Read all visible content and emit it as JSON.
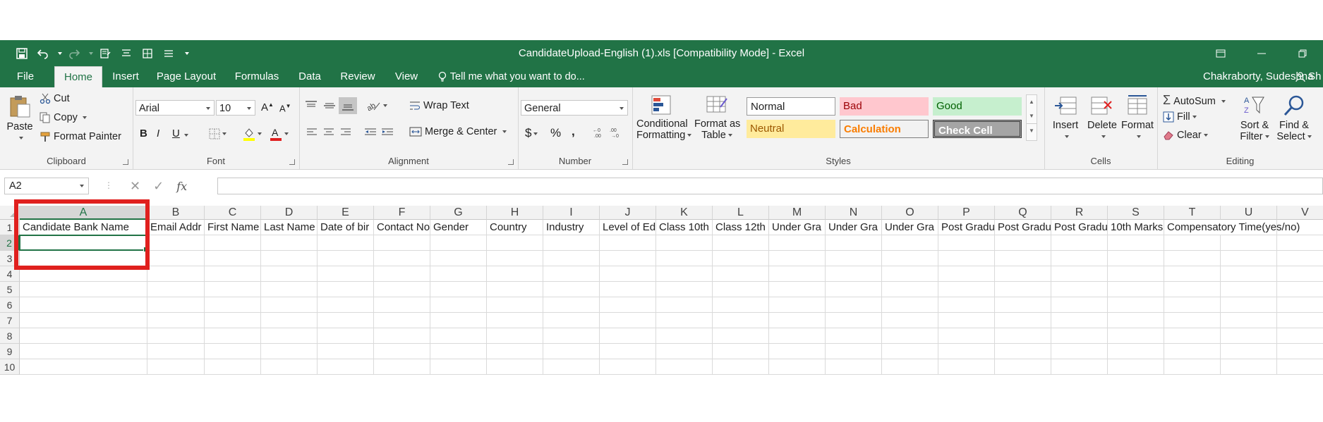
{
  "window": {
    "title": "CandidateUpload-English (1).xls  [Compatibility Mode] - Excel"
  },
  "tabs": [
    {
      "label": "File",
      "active": false
    },
    {
      "label": "Home",
      "active": true
    },
    {
      "label": "Insert",
      "active": false
    },
    {
      "label": "Page Layout",
      "active": false
    },
    {
      "label": "Formulas",
      "active": false
    },
    {
      "label": "Data",
      "active": false
    },
    {
      "label": "Review",
      "active": false
    },
    {
      "label": "View",
      "active": false
    }
  ],
  "tell_me": "Tell me what you want to do...",
  "user": "Chakraborty, Sudeshna",
  "share": "Sh",
  "ribbon": {
    "clipboard": {
      "paste": "Paste",
      "cut": "Cut",
      "copy": "Copy",
      "format_painter": "Format Painter",
      "label": "Clipboard"
    },
    "font": {
      "name": "Arial",
      "size": "10",
      "bold": "B",
      "italic": "I",
      "underline": "U",
      "label": "Font"
    },
    "alignment": {
      "wrap_text": "Wrap Text",
      "merge_center": "Merge & Center",
      "label": "Alignment"
    },
    "number": {
      "format": "General",
      "currency": "$",
      "percent": "%",
      "comma": ",",
      "label": "Number"
    },
    "styles": {
      "conditional_1": "Conditional",
      "conditional_2": "Formatting",
      "format_table_1": "Format as",
      "format_table_2": "Table",
      "normal": "Normal",
      "bad": "Bad",
      "good": "Good",
      "neutral": "Neutral",
      "calculation": "Calculation",
      "check_cell": "Check Cell",
      "label": "Styles"
    },
    "cells": {
      "insert": "Insert",
      "delete": "Delete",
      "format": "Format",
      "label": "Cells"
    },
    "editing": {
      "autosum": "AutoSum",
      "fill": "Fill",
      "clear": "Clear",
      "sort_1": "Sort &",
      "sort_2": "Filter",
      "find_1": "Find &",
      "find_2": "Select",
      "label": "Editing"
    }
  },
  "formula_bar": {
    "name_box": "A2",
    "fx": "fx",
    "value": ""
  },
  "columns": [
    "A",
    "B",
    "C",
    "D",
    "E",
    "F",
    "G",
    "H",
    "I",
    "J",
    "K",
    "L",
    "M",
    "N",
    "O",
    "P",
    "Q",
    "R",
    "S",
    "T",
    "U",
    "V"
  ],
  "rows": [
    "1",
    "2",
    "3",
    "4",
    "5",
    "6",
    "7",
    "8",
    "9",
    "10"
  ],
  "row1": [
    "Candidate Bank Name",
    "Email Addr",
    "First Name",
    "Last Name",
    "Date of bir",
    "Contact No",
    "Gender",
    "Country",
    "Industry",
    "Level of Ed",
    "Class 10th",
    "Class 12th",
    "Under Gra",
    "Under Gra",
    "Under Gra",
    "Post Gradu",
    "Post Gradu",
    "Post Gradu",
    "10th Marks",
    "Compensatory Time(yes/no)",
    "",
    ""
  ],
  "selected_cell": "A2",
  "colors": {
    "accent": "#217346",
    "highlight_box": "#e0201e"
  }
}
